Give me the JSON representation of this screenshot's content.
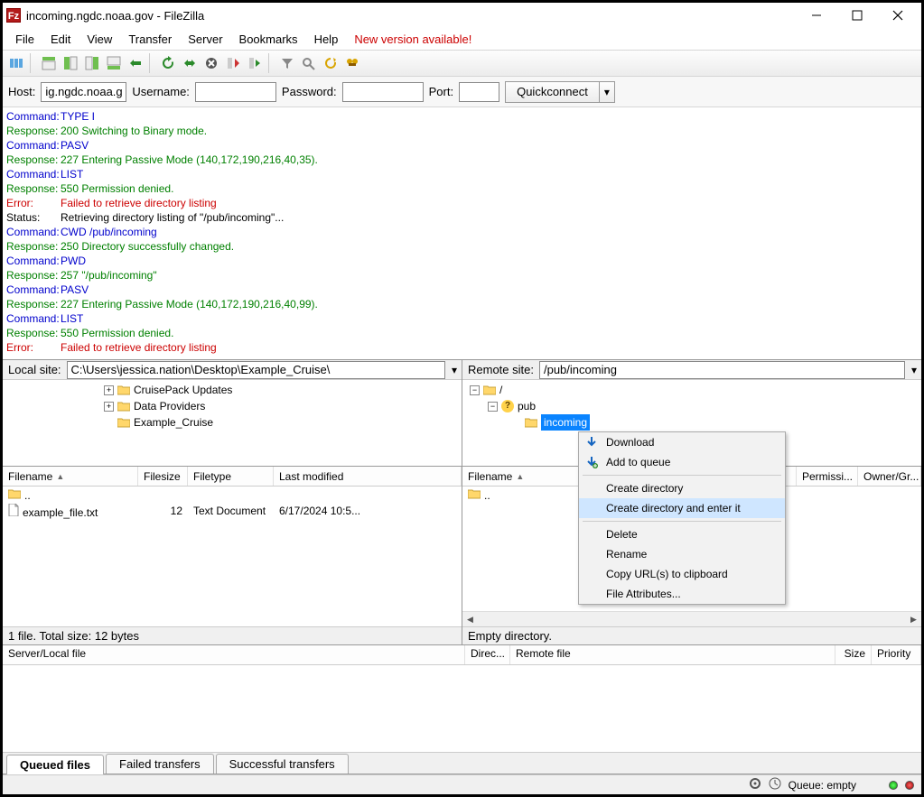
{
  "title": "incoming.ngdc.noaa.gov - FileZilla",
  "menu": [
    "File",
    "Edit",
    "View",
    "Transfer",
    "Server",
    "Bookmarks",
    "Help"
  ],
  "new_version": "New version available!",
  "quickconnect": {
    "host_label": "Host:",
    "host_value": "ig.ngdc.noaa.gov",
    "user_label": "Username:",
    "user_value": "",
    "pass_label": "Password:",
    "pass_value": "",
    "port_label": "Port:",
    "port_value": "",
    "button": "Quickconnect"
  },
  "log": [
    {
      "type": "cmd",
      "label": "Command:",
      "text": "TYPE I"
    },
    {
      "type": "resp",
      "label": "Response:",
      "text": "200 Switching to Binary mode."
    },
    {
      "type": "cmd",
      "label": "Command:",
      "text": "PASV"
    },
    {
      "type": "resp",
      "label": "Response:",
      "text": "227 Entering Passive Mode (140,172,190,216,40,35)."
    },
    {
      "type": "cmd",
      "label": "Command:",
      "text": "LIST"
    },
    {
      "type": "resp",
      "label": "Response:",
      "text": "550 Permission denied."
    },
    {
      "type": "err",
      "label": "Error:",
      "text": "Failed to retrieve directory listing"
    },
    {
      "type": "stat",
      "label": "Status:",
      "text": "Retrieving directory listing of \"/pub/incoming\"..."
    },
    {
      "type": "cmd",
      "label": "Command:",
      "text": "CWD /pub/incoming"
    },
    {
      "type": "resp",
      "label": "Response:",
      "text": "250 Directory successfully changed."
    },
    {
      "type": "cmd",
      "label": "Command:",
      "text": "PWD"
    },
    {
      "type": "resp",
      "label": "Response:",
      "text": "257 \"/pub/incoming\""
    },
    {
      "type": "cmd",
      "label": "Command:",
      "text": "PASV"
    },
    {
      "type": "resp",
      "label": "Response:",
      "text": "227 Entering Passive Mode (140,172,190,216,40,99)."
    },
    {
      "type": "cmd",
      "label": "Command:",
      "text": "LIST"
    },
    {
      "type": "resp",
      "label": "Response:",
      "text": "550 Permission denied."
    },
    {
      "type": "err",
      "label": "Error:",
      "text": "Failed to retrieve directory listing"
    }
  ],
  "local": {
    "label": "Local site:",
    "path": "C:\\Users\\jessica.nation\\Desktop\\Example_Cruise\\",
    "tree": [
      {
        "indent": 6,
        "exp": "+",
        "name": "CruisePack Updates"
      },
      {
        "indent": 6,
        "exp": "+",
        "name": "Data Providers"
      },
      {
        "indent": 6,
        "exp": "",
        "name": "Example_Cruise"
      }
    ],
    "cols": {
      "fn": "Filename",
      "fs": "Filesize",
      "ft": "Filetype",
      "lm": "Last modified"
    },
    "rows": [
      {
        "name": "..",
        "size": "",
        "type": "",
        "mod": "",
        "icon": "folder"
      },
      {
        "name": "example_file.txt",
        "size": "12",
        "type": "Text Document",
        "mod": "6/17/2024 10:5...",
        "icon": "file"
      }
    ],
    "status": "1 file. Total size: 12 bytes"
  },
  "remote": {
    "label": "Remote site:",
    "path": "/pub/incoming",
    "root": "/",
    "pub": "pub",
    "incoming": "incoming",
    "cols": {
      "fn": "Filename",
      "perm": "Permissi...",
      "own": "Owner/Gr..."
    },
    "rows": [
      {
        "name": "..",
        "icon": "folder"
      }
    ],
    "status": "Empty directory."
  },
  "context_menu": {
    "download": "Download",
    "add_queue": "Add to queue",
    "create_dir": "Create directory",
    "create_dir_enter": "Create directory and enter it",
    "delete": "Delete",
    "rename": "Rename",
    "copy_url": "Copy URL(s) to clipboard",
    "file_attrs": "File Attributes..."
  },
  "queue": {
    "cols": {
      "sl": "Server/Local file",
      "dir": "Direc...",
      "rf": "Remote file",
      "size": "Size",
      "prio": "Priority"
    }
  },
  "tabs": {
    "queued": "Queued files",
    "failed": "Failed transfers",
    "success": "Successful transfers"
  },
  "statusbar": {
    "queue": "Queue: empty"
  }
}
